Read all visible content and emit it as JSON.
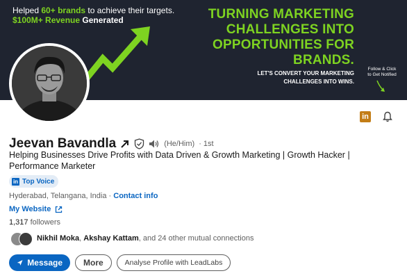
{
  "banner": {
    "left_line1_pre": "Helped ",
    "left_line1_hl": "60+ brands",
    "left_line1_post": " to achieve their targets.",
    "left_line2_hl": "$100M+ Revenue",
    "left_line2_post": " Generated",
    "headline_1": "TURNING MARKETING",
    "headline_2": "CHALLENGES INTO",
    "headline_3": "OPPORTUNITIES FOR",
    "headline_4": "BRANDS.",
    "subline_1": "LET'S CONVERT YOUR MARKETING",
    "subline_2": "CHALLENGES INTO WINS.",
    "follow_1": "Follow & Click",
    "follow_2": "to Get Notified",
    "accent_color": "#7ed321"
  },
  "profile": {
    "name": "Jeevan Bavandla",
    "pronouns": "(He/Him)",
    "degree": "· 1st",
    "headline": "Helping Businesses Drive Profits with Data Driven & Growth Marketing | Growth Hacker | Performance Marketer",
    "badge": "Top Voice",
    "location": "Hyderabad, Telangana, India",
    "location_sep": " · ",
    "contact_info": "Contact info",
    "website": "My Website",
    "followers_count": "1,317",
    "followers_label": " followers",
    "mutual_1": "Nikhil Moka",
    "mutual_sep": ", ",
    "mutual_2": "Akshay Kattam",
    "mutual_rest": ", and 24 other mutual connections"
  },
  "actions": {
    "message": "Message",
    "more": "More",
    "leadlabs": "Analyse Profile with LeadLabs"
  },
  "icons": {
    "linkedin": "linkedin-icon",
    "bell": "bell-icon",
    "verified": "verified-shield-icon",
    "speaker": "speaker-icon",
    "external": "external-link-icon",
    "send": "send-icon"
  },
  "colors": {
    "brand_blue": "#0a66c2",
    "banner_bg": "#1f2430"
  }
}
